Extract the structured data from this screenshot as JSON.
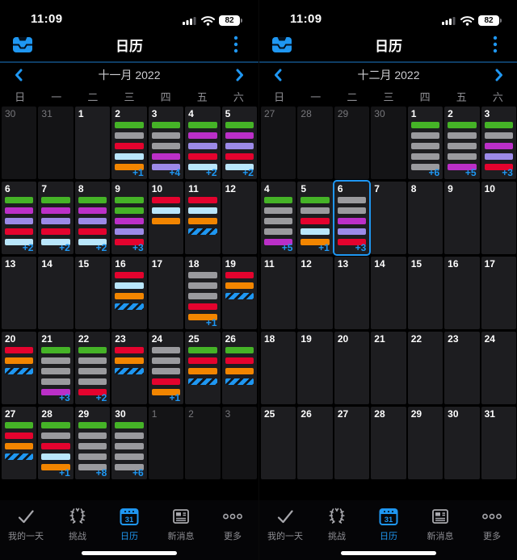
{
  "status_bar": {
    "time": "11:09",
    "battery_percent": "82"
  },
  "header": {
    "title": "日历"
  },
  "weekdays": [
    "日",
    "一",
    "二",
    "三",
    "四",
    "五",
    "六"
  ],
  "colors": {
    "accent_blue": "#1f97f2",
    "bar_green": "#45b327",
    "bar_gray": "#9a9a9e",
    "bar_red": "#e4032e",
    "bar_lightblue": "#b9e6fb",
    "bar_orange": "#f28500",
    "bar_magenta": "#bb2fc8",
    "bar_purple": "#9c8ae8",
    "bar_striped_base": "#1f97f2",
    "bar_striped_stripe": "#10151b"
  },
  "tab_bar": {
    "items": [
      {
        "label": "我的一天",
        "icon": "checkmark-icon",
        "active": false
      },
      {
        "label": "挑战",
        "icon": "laurel-icon",
        "active": false
      },
      {
        "label": "日历",
        "icon": "calendar-icon",
        "badge": "31",
        "active": true
      },
      {
        "label": "新消息",
        "icon": "news-icon",
        "active": false
      },
      {
        "label": "更多",
        "icon": "ellipsis-icon",
        "active": false
      }
    ]
  },
  "panels": [
    {
      "month_label": "十一月 2022",
      "weeks": [
        [
          {
            "day": "30",
            "other": true
          },
          {
            "day": "31",
            "other": true
          },
          {
            "day": "1"
          },
          {
            "day": "2",
            "bars": [
              "green",
              "gray",
              "red",
              "lightblue",
              "orange"
            ],
            "more": "+1"
          },
          {
            "day": "3",
            "bars": [
              "green",
              "gray",
              "gray",
              "magenta",
              "purple"
            ],
            "more": "+4"
          },
          {
            "day": "4",
            "bars": [
              "green",
              "magenta",
              "purple",
              "red",
              "lightblue"
            ],
            "more": "+2"
          },
          {
            "day": "5",
            "bars": [
              "green",
              "magenta",
              "purple",
              "red",
              "lightblue"
            ],
            "more": "+2"
          }
        ],
        [
          {
            "day": "6",
            "bars": [
              "green",
              "magenta",
              "purple",
              "red",
              "lightblue"
            ],
            "more": "+2"
          },
          {
            "day": "7",
            "bars": [
              "green",
              "magenta",
              "purple",
              "red",
              "lightblue"
            ],
            "more": "+2"
          },
          {
            "day": "8",
            "bars": [
              "green",
              "magenta",
              "purple",
              "red",
              "lightblue"
            ],
            "more": "+2"
          },
          {
            "day": "9",
            "bars": [
              "green",
              "green",
              "magenta",
              "purple",
              "red"
            ],
            "more": "+3"
          },
          {
            "day": "10",
            "bars": [
              "red",
              "lightblue",
              "orange"
            ]
          },
          {
            "day": "11",
            "bars": [
              "red",
              "lightblue",
              "orange",
              "striped"
            ]
          },
          {
            "day": "12"
          }
        ],
        [
          {
            "day": "13"
          },
          {
            "day": "14"
          },
          {
            "day": "15"
          },
          {
            "day": "16",
            "bars": [
              "red",
              "lightblue",
              "orange",
              "striped"
            ]
          },
          {
            "day": "17"
          },
          {
            "day": "18",
            "bars": [
              "gray",
              "gray",
              "gray",
              "red",
              "orange"
            ],
            "more": "+1"
          },
          {
            "day": "19",
            "bars": [
              "red",
              "orange",
              "striped"
            ]
          }
        ],
        [
          {
            "day": "20",
            "bars": [
              "red",
              "orange",
              "striped"
            ]
          },
          {
            "day": "21",
            "bars": [
              "green",
              "gray",
              "gray",
              "gray",
              "magenta"
            ],
            "more": "+3"
          },
          {
            "day": "22",
            "bars": [
              "green",
              "gray",
              "gray",
              "gray",
              "red"
            ],
            "more": "+2"
          },
          {
            "day": "23",
            "bars": [
              "red",
              "orange",
              "striped"
            ]
          },
          {
            "day": "24",
            "bars": [
              "gray",
              "gray",
              "gray",
              "red",
              "orange"
            ],
            "more": "+1"
          },
          {
            "day": "25",
            "bars": [
              "green",
              "red",
              "orange",
              "striped"
            ]
          },
          {
            "day": "26",
            "bars": [
              "green",
              "red",
              "orange",
              "striped"
            ]
          }
        ],
        [
          {
            "day": "27",
            "bars": [
              "green",
              "red",
              "orange",
              "striped"
            ]
          },
          {
            "day": "28",
            "bars": [
              "green",
              "gray",
              "red",
              "lightblue",
              "orange"
            ],
            "more": "+1"
          },
          {
            "day": "29",
            "bars": [
              "green",
              "gray",
              "gray",
              "gray",
              "gray"
            ],
            "more": "+8"
          },
          {
            "day": "30",
            "bars": [
              "green",
              "gray",
              "gray",
              "gray",
              "gray"
            ],
            "more": "+6"
          },
          {
            "day": "1",
            "other": true
          },
          {
            "day": "2",
            "other": true
          },
          {
            "day": "3",
            "other": true
          }
        ]
      ]
    },
    {
      "month_label": "十二月 2022",
      "weeks": [
        [
          {
            "day": "27",
            "other": true
          },
          {
            "day": "28",
            "other": true
          },
          {
            "day": "29",
            "other": true
          },
          {
            "day": "30",
            "other": true
          },
          {
            "day": "1",
            "bars": [
              "green",
              "gray",
              "gray",
              "gray",
              "gray"
            ],
            "more": "+6"
          },
          {
            "day": "2",
            "bars": [
              "green",
              "gray",
              "gray",
              "gray",
              "magenta"
            ],
            "more": "+5"
          },
          {
            "day": "3",
            "bars": [
              "green",
              "gray",
              "magenta",
              "purple",
              "red"
            ],
            "more": "+3"
          }
        ],
        [
          {
            "day": "4",
            "bars": [
              "green",
              "gray",
              "gray",
              "gray",
              "magenta"
            ],
            "more": "+5"
          },
          {
            "day": "5",
            "bars": [
              "green",
              "gray",
              "red",
              "lightblue",
              "orange"
            ],
            "more": "+1"
          },
          {
            "day": "6",
            "bars": [
              "gray",
              "gray",
              "magenta",
              "purple",
              "red"
            ],
            "more": "+3",
            "selected": true
          },
          {
            "day": "7"
          },
          {
            "day": "8"
          },
          {
            "day": "9"
          },
          {
            "day": "10"
          }
        ],
        [
          {
            "day": "11"
          },
          {
            "day": "12"
          },
          {
            "day": "13"
          },
          {
            "day": "14"
          },
          {
            "day": "15"
          },
          {
            "day": "16"
          },
          {
            "day": "17"
          }
        ],
        [
          {
            "day": "18"
          },
          {
            "day": "19"
          },
          {
            "day": "20"
          },
          {
            "day": "21"
          },
          {
            "day": "22"
          },
          {
            "day": "23"
          },
          {
            "day": "24"
          }
        ],
        [
          {
            "day": "25"
          },
          {
            "day": "26"
          },
          {
            "day": "27"
          },
          {
            "day": "28"
          },
          {
            "day": "29"
          },
          {
            "day": "30"
          },
          {
            "day": "31"
          }
        ]
      ]
    }
  ]
}
